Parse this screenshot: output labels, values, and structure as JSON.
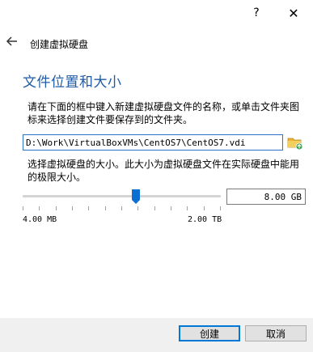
{
  "titlebar": {
    "help_label": "?",
    "close_label": "✕"
  },
  "header": {
    "back_icon": "arrow-left-icon",
    "title": "创建虚拟硬盘"
  },
  "section": {
    "title": "文件位置和大小"
  },
  "location": {
    "description": "请在下面的框中键入新建虚拟硬盘文件的名称，或单击文件夹图标来选择创建文件要保存到的文件夹。",
    "path_value": "D:\\Work\\VirtualBoxVMs\\CentOS7\\CentOS7.vdi",
    "folder_icon": "folder-browse-icon"
  },
  "size": {
    "description": "选择虚拟硬盘的大小。此大小为虚拟硬盘文件在实际硬盘中能用的极限大小。",
    "min_label": "4.00 MB",
    "max_label": "2.00 TB",
    "value": "8.00 GB",
    "slider_fraction": 0.57
  },
  "buttons": {
    "create": "创建",
    "cancel": "取消"
  },
  "colors": {
    "accent": "#1f5ba6",
    "focus": "#0078d7",
    "slider_thumb": "#0a6fd1"
  }
}
